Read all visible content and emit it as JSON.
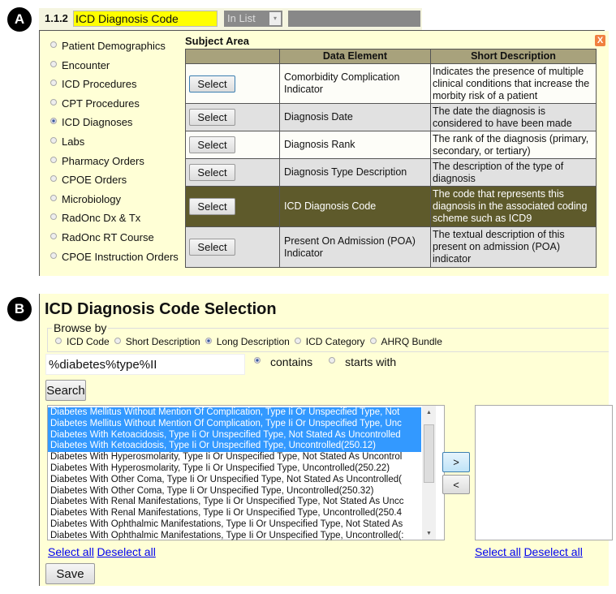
{
  "section_a": {
    "badge": "A",
    "field_number": "1.1.2",
    "field_value": "ICD Diagnosis Code",
    "operator_select": "In List",
    "subject_area_title": "Subject Area",
    "close_label": "X",
    "subject_areas": [
      {
        "label": "Patient Demographics",
        "selected": false
      },
      {
        "label": "Encounter",
        "selected": false
      },
      {
        "label": "ICD Procedures",
        "selected": false
      },
      {
        "label": "CPT Procedures",
        "selected": false
      },
      {
        "label": "ICD Diagnoses",
        "selected": true
      },
      {
        "label": "Labs",
        "selected": false
      },
      {
        "label": "Pharmacy Orders",
        "selected": false
      },
      {
        "label": "CPOE Orders",
        "selected": false
      },
      {
        "label": "Microbiology",
        "selected": false
      },
      {
        "label": "RadOnc Dx & Tx",
        "selected": false
      },
      {
        "label": "RadOnc RT Course",
        "selected": false
      },
      {
        "label": "CPOE Instruction Orders",
        "selected": false
      }
    ],
    "table": {
      "headers": [
        "",
        "Data Element",
        "Short Description"
      ],
      "rows": [
        {
          "button": "Select",
          "element": "Comorbidity Complication Indicator",
          "description": "Indicates the presence of multiple clinical conditions that increase the morbity risk of a patient"
        },
        {
          "button": "Select",
          "element": "Diagnosis Date",
          "description": "The date the diagnosis is considered to have been made"
        },
        {
          "button": "Select",
          "element": "Diagnosis Rank",
          "description": "The rank of the diagnosis (primary, secondary, or tertiary)"
        },
        {
          "button": "Select",
          "element": "Diagnosis Type Description",
          "description": "The description of the type of diagnosis"
        },
        {
          "button": "Select",
          "element": "ICD Diagnosis Code",
          "description": "The code that represents this diagnosis in the associated coding scheme such as ICD9",
          "highlighted": true
        },
        {
          "button": "Select",
          "element": "Present On Admission (POA) Indicator",
          "description": "The textual description of this present on admission (POA) indicator"
        }
      ]
    },
    "colors": {
      "panel": "#ffffd6",
      "header": "#a8a27c",
      "highlight": "#5e5a2b",
      "field": "#ffff00"
    }
  },
  "section_b": {
    "badge": "B",
    "title": "ICD Diagnosis Code Selection",
    "browse_by_label": "Browse by",
    "browse_options": [
      {
        "label": "ICD Code",
        "selected": false
      },
      {
        "label": "Short Description",
        "selected": false
      },
      {
        "label": "Long Description",
        "selected": true
      },
      {
        "label": "ICD Category",
        "selected": false
      },
      {
        "label": "AHRQ Bundle",
        "selected": false
      }
    ],
    "search_value": "%diabetes%type%II",
    "match_options": [
      {
        "label": "contains",
        "selected": true
      },
      {
        "label": "starts with",
        "selected": false
      }
    ],
    "search_button": "Search",
    "results": [
      {
        "text": "Diabetes Mellitus Without Mention Of Complication, Type Ii Or Unspecified Type, Not",
        "selected": true
      },
      {
        "text": "Diabetes Mellitus Without Mention Of Complication, Type Ii Or Unspecified Type, Unc",
        "selected": true
      },
      {
        "text": "Diabetes With Ketoacidosis, Type Ii Or Unspecified Type, Not Stated As Uncontrolled",
        "selected": true
      },
      {
        "text": "Diabetes With Ketoacidosis, Type Ii Or Unspecified Type, Uncontrolled(250.12)",
        "selected": true
      },
      {
        "text": "Diabetes With Hyperosmolarity, Type Ii Or Unspecified Type, Not Stated As Uncontrol",
        "selected": false
      },
      {
        "text": "Diabetes With Hyperosmolarity, Type Ii Or Unspecified Type, Uncontrolled(250.22)",
        "selected": false
      },
      {
        "text": "Diabetes With Other Coma, Type Ii Or Unspecified Type, Not Stated As Uncontrolled(",
        "selected": false
      },
      {
        "text": "Diabetes With Other Coma, Type Ii Or Unspecified Type, Uncontrolled(250.32)",
        "selected": false
      },
      {
        "text": "Diabetes With Renal Manifestations, Type Ii Or Unspecified Type, Not Stated As Uncc",
        "selected": false
      },
      {
        "text": "Diabetes With Renal Manifestations, Type Ii Or Unspecified Type, Uncontrolled(250.4",
        "selected": false
      },
      {
        "text": "Diabetes With Ophthalmic Manifestations, Type Ii Or Unspecified Type, Not Stated As",
        "selected": false
      },
      {
        "text": "Diabetes With Ophthalmic Manifestations, Type Ii Or Unspecified Type, Uncontrolled(:",
        "selected": false
      }
    ],
    "add_button": ">",
    "remove_button": "<",
    "select_all": "Select all",
    "deselect_all": "Deselect all",
    "save_button": "Save",
    "colors": {
      "selection": "#3399ff"
    }
  }
}
